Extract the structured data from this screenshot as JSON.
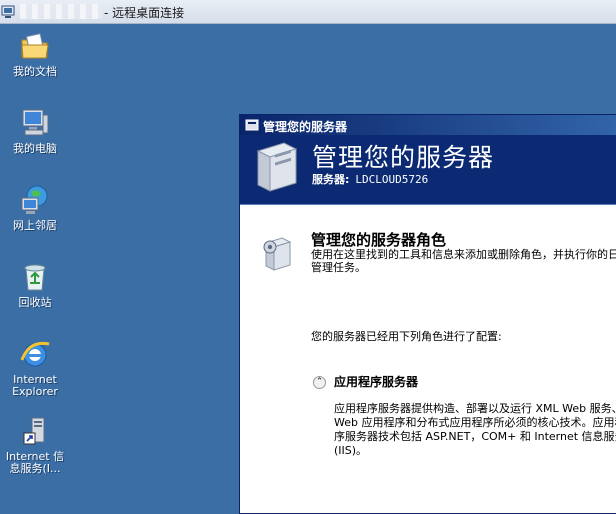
{
  "rdp": {
    "title": "- 远程桌面连接"
  },
  "desktop": {
    "icons": [
      {
        "label": "我的文档",
        "icon": "folder-documents-icon"
      },
      {
        "label": "我的电脑",
        "icon": "computer-icon"
      },
      {
        "label": "网上邻居",
        "icon": "network-icon"
      },
      {
        "label": "回收站",
        "icon": "recycle-bin-icon"
      },
      {
        "label": "Internet\nExplorer",
        "icon": "internet-explorer-icon"
      },
      {
        "label": "Internet 信\n息服务(I...",
        "icon": "iis-shortcut-icon"
      }
    ]
  },
  "window": {
    "title": "管理您的服务器",
    "banner_title": "管理您的服务器",
    "server_label": "服务器:",
    "server_name": "LDCLOUD5726",
    "role_heading": "管理您的服务器角色",
    "role_description": "使用在这里找到的工具和信息来添加或删除角色，并执行你的日常管理任务。",
    "configured_text": "您的服务器已经用下列角色进行了配置:",
    "app_server": {
      "title": "应用程序服务器",
      "description": "应用程序服务器提供构造、部署以及运行 XML Web 服务、Web 应用程序和分布式应用程序所必须的核心技术。应用程序服务器技术包括 ASP.NET，COM+ 和 Internet 信息服务(IIS)。"
    }
  },
  "colors": {
    "desktop": "#3a6ea5",
    "banner": "#0b2a73",
    "titlebar": "#0a246a"
  }
}
